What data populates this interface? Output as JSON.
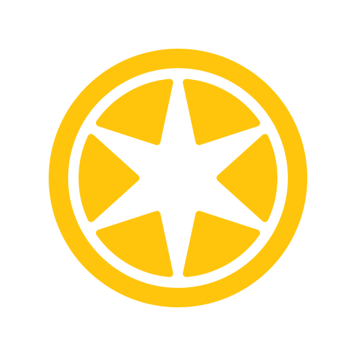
{
  "image": {
    "subject_icon": "lemon-slice-icon",
    "colors": {
      "background": "#FFFFFF",
      "accent": "#FFC50D",
      "pith": "#FFFFFF"
    },
    "segment_count": 6
  }
}
